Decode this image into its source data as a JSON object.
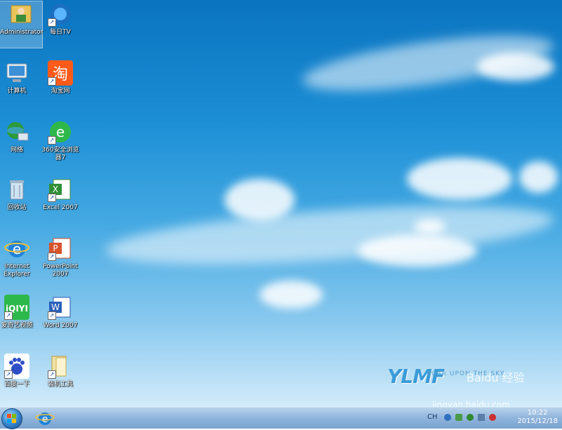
{
  "desktop_icons": [
    {
      "label": "Administrator",
      "icon": "user-folder-icon",
      "selected": true
    },
    {
      "label": "每日TV",
      "icon": "tv-app-icon"
    },
    {
      "label": "计算机",
      "icon": "computer-icon"
    },
    {
      "label": "淘宝网",
      "icon": "taobao-icon"
    },
    {
      "label": "网络",
      "icon": "network-icon"
    },
    {
      "label": "360安全浏览器7",
      "icon": "360-browser-icon"
    },
    {
      "label": "回收站",
      "icon": "recycle-bin-icon"
    },
    {
      "label": "Excel 2007",
      "icon": "excel-icon"
    },
    {
      "label": "Internet Explorer",
      "icon": "ie-icon"
    },
    {
      "label": "PowerPoint 2007",
      "icon": "powerpoint-icon"
    },
    {
      "label": "爱奇艺视频",
      "icon": "iqiyi-icon"
    },
    {
      "label": "Word 2007",
      "icon": "word-icon"
    },
    {
      "label": "百度一下",
      "icon": "baidu-icon"
    },
    {
      "label": "装机工具",
      "icon": "folder-icon"
    }
  ],
  "wallpaper_logo": {
    "brand": "YLMF",
    "tagline": "SOAR UPON THE SKY"
  },
  "watermark": {
    "text": "jingyan.baidu.com",
    "brand": "Baidu 经验"
  },
  "taskbar": {
    "pinned": [
      {
        "icon": "ie-icon"
      }
    ],
    "tray": {
      "ime": "CH",
      "time": "10:22",
      "date": "2015/12/18"
    }
  },
  "colors": {
    "sky_top": "#0a73bf",
    "sky_bottom": "#d3ecfa",
    "taskbar": "#8fb4dc"
  }
}
